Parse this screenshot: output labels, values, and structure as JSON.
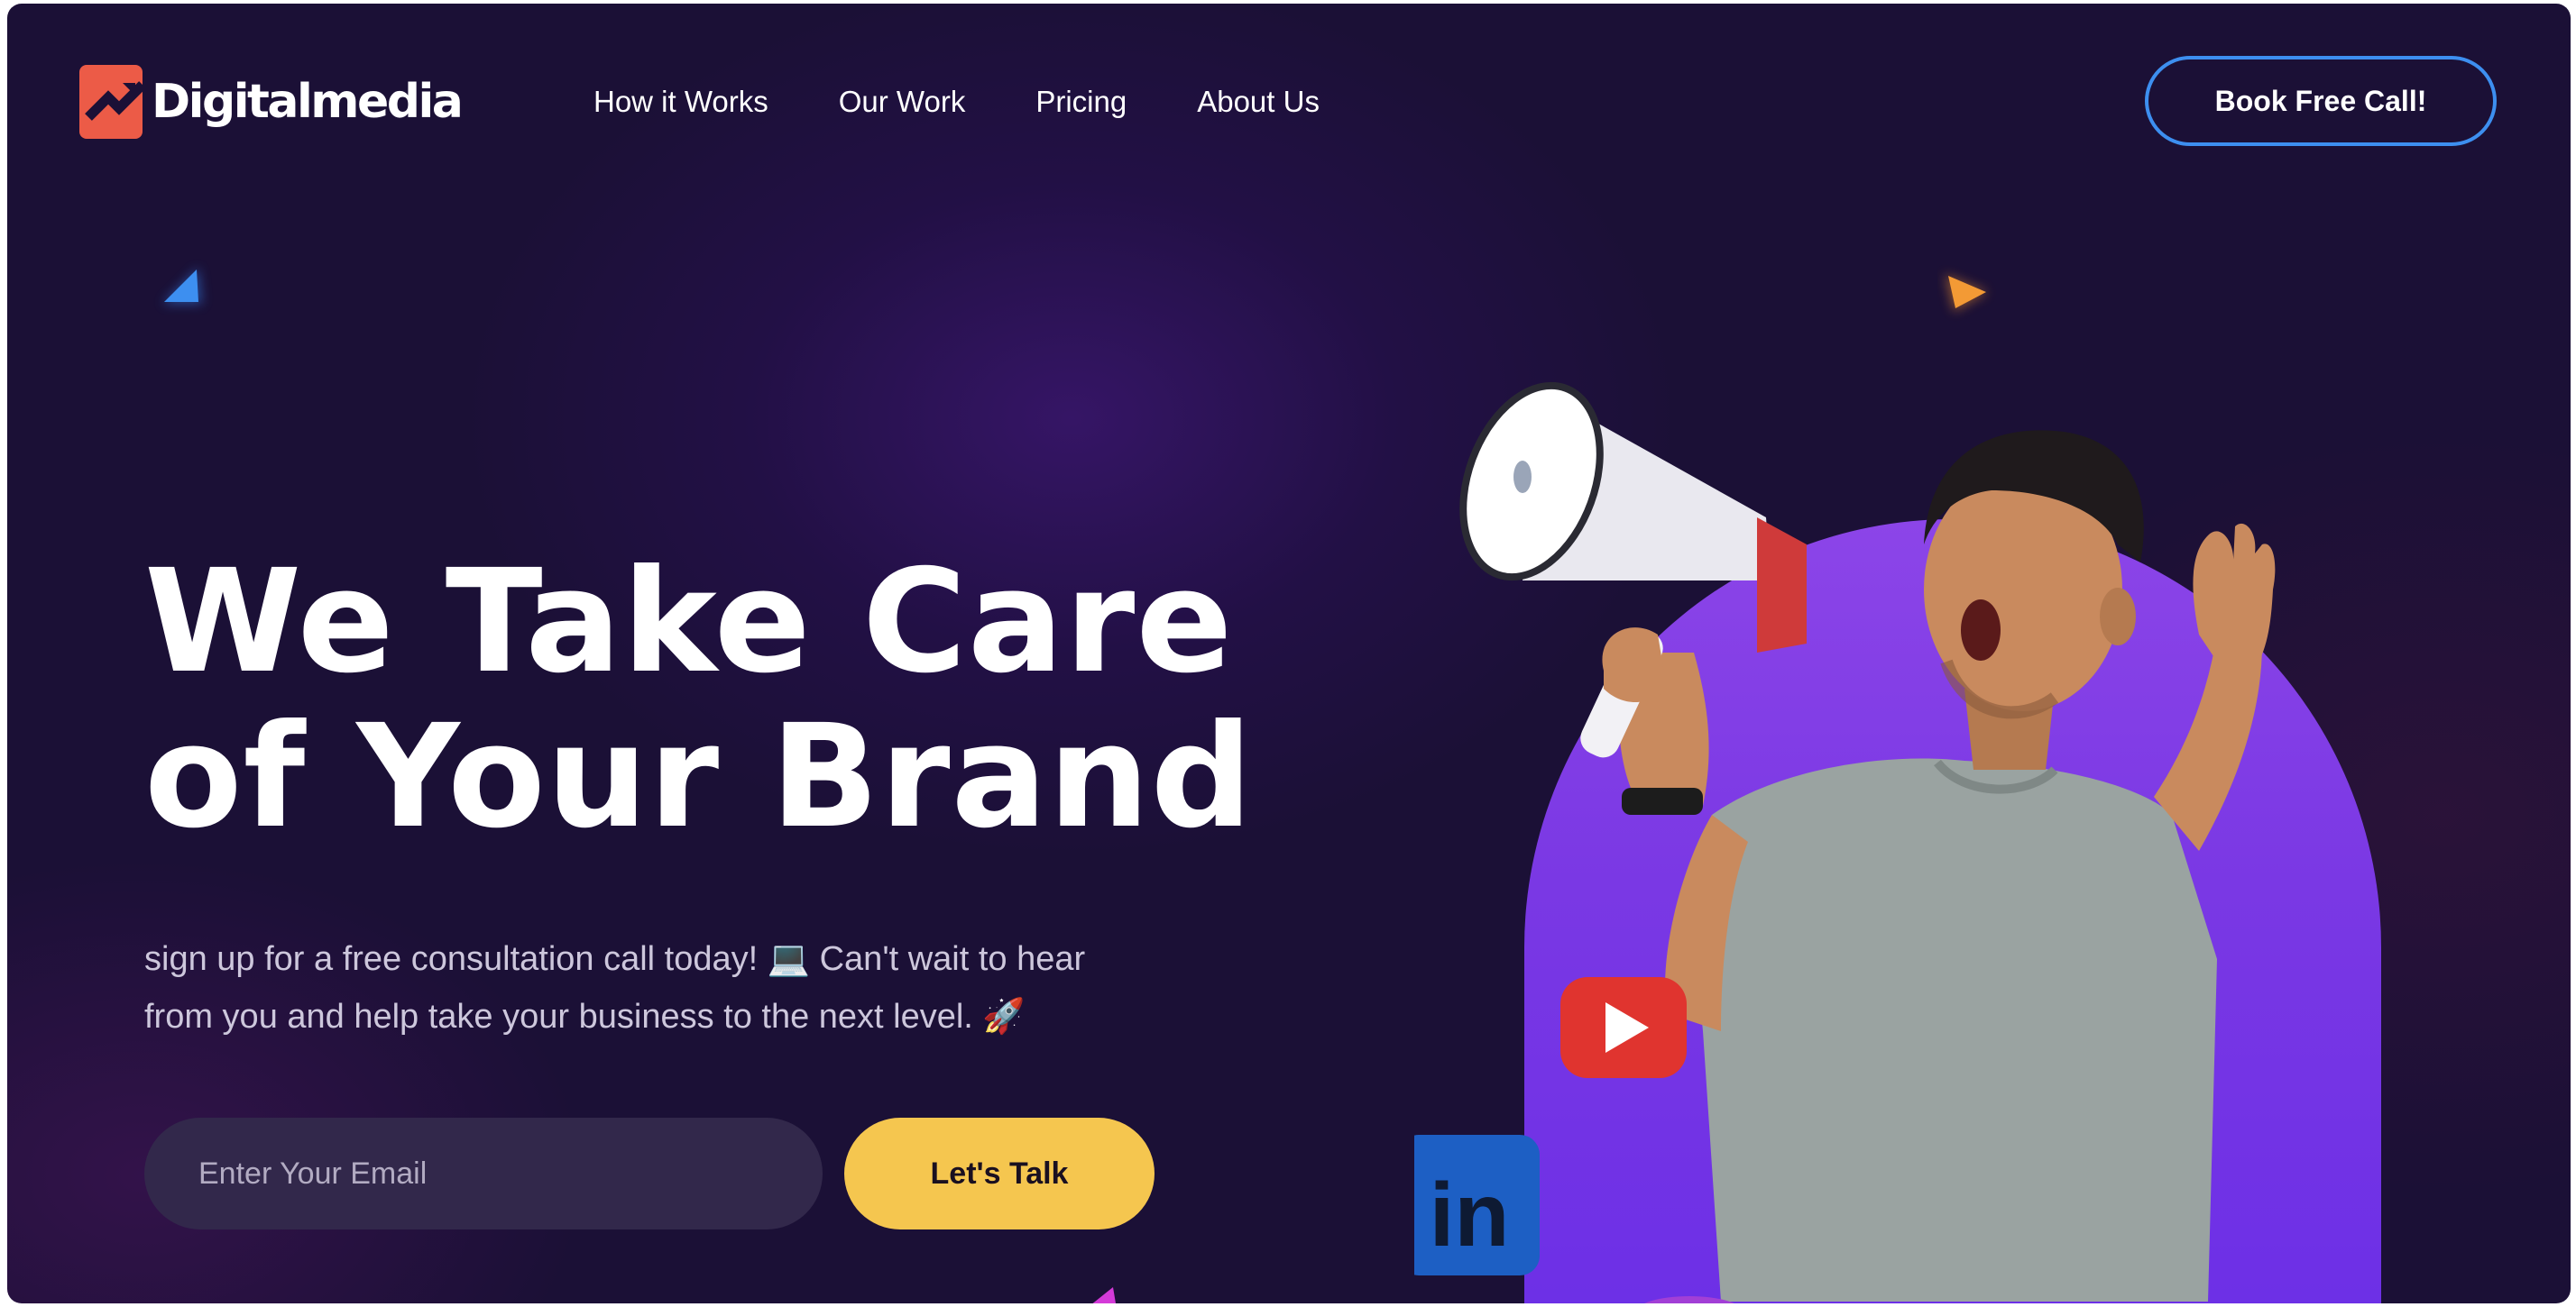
{
  "brand": {
    "name": "Digitalmedia",
    "logo_color": "#ec5b47"
  },
  "nav": {
    "items": [
      {
        "label": "How it Works"
      },
      {
        "label": "Our Work"
      },
      {
        "label": "Pricing"
      },
      {
        "label": "About Us"
      }
    ]
  },
  "header": {
    "cta_label": "Book Free Call!",
    "cta_border_color": "#3d8ff0"
  },
  "hero": {
    "headline_line1": "We Take Care",
    "headline_line2": "of Your Brand",
    "subtitle_line1": "sign up for a free consultation call today! 💻 Can't wait to hear",
    "subtitle_line2": "from you and help take your business to the next level. 🚀",
    "email_placeholder": "Enter Your Email",
    "email_value": "",
    "cta_label": "Let's Talk",
    "cta_color": "#f5c64f"
  },
  "illustration": {
    "subject": "man shouting into megaphone",
    "icons": [
      "youtube-icon",
      "linkedin-icon"
    ],
    "arch_color": "#7a38e4"
  },
  "theme": {
    "background": "#1b1036",
    "text": "#ffffff"
  }
}
